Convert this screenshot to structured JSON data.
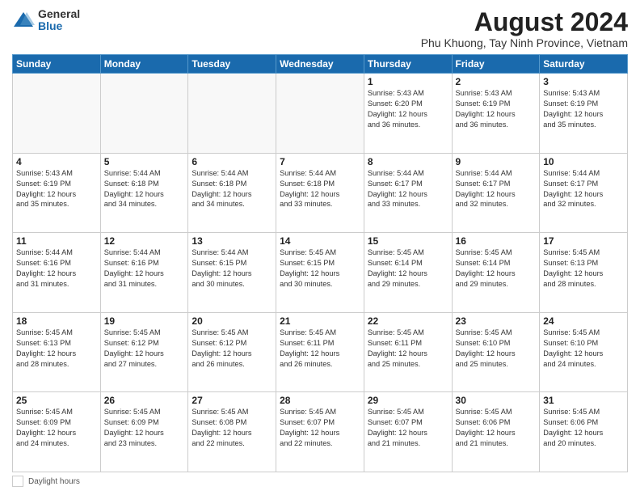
{
  "logo": {
    "general": "General",
    "blue": "Blue"
  },
  "header": {
    "title": "August 2024",
    "subtitle": "Phu Khuong, Tay Ninh Province, Vietnam"
  },
  "weekdays": [
    "Sunday",
    "Monday",
    "Tuesday",
    "Wednesday",
    "Thursday",
    "Friday",
    "Saturday"
  ],
  "footer": {
    "label": "Daylight hours"
  },
  "weeks": [
    [
      {
        "day": "",
        "info": ""
      },
      {
        "day": "",
        "info": ""
      },
      {
        "day": "",
        "info": ""
      },
      {
        "day": "",
        "info": ""
      },
      {
        "day": "1",
        "info": "Sunrise: 5:43 AM\nSunset: 6:20 PM\nDaylight: 12 hours\nand 36 minutes."
      },
      {
        "day": "2",
        "info": "Sunrise: 5:43 AM\nSunset: 6:19 PM\nDaylight: 12 hours\nand 36 minutes."
      },
      {
        "day": "3",
        "info": "Sunrise: 5:43 AM\nSunset: 6:19 PM\nDaylight: 12 hours\nand 35 minutes."
      }
    ],
    [
      {
        "day": "4",
        "info": "Sunrise: 5:43 AM\nSunset: 6:19 PM\nDaylight: 12 hours\nand 35 minutes."
      },
      {
        "day": "5",
        "info": "Sunrise: 5:44 AM\nSunset: 6:18 PM\nDaylight: 12 hours\nand 34 minutes."
      },
      {
        "day": "6",
        "info": "Sunrise: 5:44 AM\nSunset: 6:18 PM\nDaylight: 12 hours\nand 34 minutes."
      },
      {
        "day": "7",
        "info": "Sunrise: 5:44 AM\nSunset: 6:18 PM\nDaylight: 12 hours\nand 33 minutes."
      },
      {
        "day": "8",
        "info": "Sunrise: 5:44 AM\nSunset: 6:17 PM\nDaylight: 12 hours\nand 33 minutes."
      },
      {
        "day": "9",
        "info": "Sunrise: 5:44 AM\nSunset: 6:17 PM\nDaylight: 12 hours\nand 32 minutes."
      },
      {
        "day": "10",
        "info": "Sunrise: 5:44 AM\nSunset: 6:17 PM\nDaylight: 12 hours\nand 32 minutes."
      }
    ],
    [
      {
        "day": "11",
        "info": "Sunrise: 5:44 AM\nSunset: 6:16 PM\nDaylight: 12 hours\nand 31 minutes."
      },
      {
        "day": "12",
        "info": "Sunrise: 5:44 AM\nSunset: 6:16 PM\nDaylight: 12 hours\nand 31 minutes."
      },
      {
        "day": "13",
        "info": "Sunrise: 5:44 AM\nSunset: 6:15 PM\nDaylight: 12 hours\nand 30 minutes."
      },
      {
        "day": "14",
        "info": "Sunrise: 5:45 AM\nSunset: 6:15 PM\nDaylight: 12 hours\nand 30 minutes."
      },
      {
        "day": "15",
        "info": "Sunrise: 5:45 AM\nSunset: 6:14 PM\nDaylight: 12 hours\nand 29 minutes."
      },
      {
        "day": "16",
        "info": "Sunrise: 5:45 AM\nSunset: 6:14 PM\nDaylight: 12 hours\nand 29 minutes."
      },
      {
        "day": "17",
        "info": "Sunrise: 5:45 AM\nSunset: 6:13 PM\nDaylight: 12 hours\nand 28 minutes."
      }
    ],
    [
      {
        "day": "18",
        "info": "Sunrise: 5:45 AM\nSunset: 6:13 PM\nDaylight: 12 hours\nand 28 minutes."
      },
      {
        "day": "19",
        "info": "Sunrise: 5:45 AM\nSunset: 6:12 PM\nDaylight: 12 hours\nand 27 minutes."
      },
      {
        "day": "20",
        "info": "Sunrise: 5:45 AM\nSunset: 6:12 PM\nDaylight: 12 hours\nand 26 minutes."
      },
      {
        "day": "21",
        "info": "Sunrise: 5:45 AM\nSunset: 6:11 PM\nDaylight: 12 hours\nand 26 minutes."
      },
      {
        "day": "22",
        "info": "Sunrise: 5:45 AM\nSunset: 6:11 PM\nDaylight: 12 hours\nand 25 minutes."
      },
      {
        "day": "23",
        "info": "Sunrise: 5:45 AM\nSunset: 6:10 PM\nDaylight: 12 hours\nand 25 minutes."
      },
      {
        "day": "24",
        "info": "Sunrise: 5:45 AM\nSunset: 6:10 PM\nDaylight: 12 hours\nand 24 minutes."
      }
    ],
    [
      {
        "day": "25",
        "info": "Sunrise: 5:45 AM\nSunset: 6:09 PM\nDaylight: 12 hours\nand 24 minutes."
      },
      {
        "day": "26",
        "info": "Sunrise: 5:45 AM\nSunset: 6:09 PM\nDaylight: 12 hours\nand 23 minutes."
      },
      {
        "day": "27",
        "info": "Sunrise: 5:45 AM\nSunset: 6:08 PM\nDaylight: 12 hours\nand 22 minutes."
      },
      {
        "day": "28",
        "info": "Sunrise: 5:45 AM\nSunset: 6:07 PM\nDaylight: 12 hours\nand 22 minutes."
      },
      {
        "day": "29",
        "info": "Sunrise: 5:45 AM\nSunset: 6:07 PM\nDaylight: 12 hours\nand 21 minutes."
      },
      {
        "day": "30",
        "info": "Sunrise: 5:45 AM\nSunset: 6:06 PM\nDaylight: 12 hours\nand 21 minutes."
      },
      {
        "day": "31",
        "info": "Sunrise: 5:45 AM\nSunset: 6:06 PM\nDaylight: 12 hours\nand 20 minutes."
      }
    ]
  ]
}
